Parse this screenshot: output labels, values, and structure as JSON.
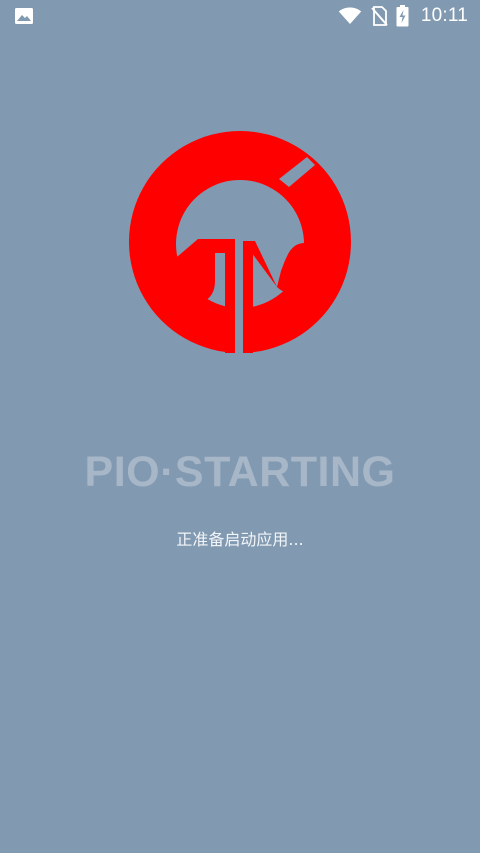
{
  "status_bar": {
    "time": "10:11",
    "icons": [
      "image-icon",
      "wifi-icon",
      "no-sim-icon",
      "battery-charging-icon"
    ]
  },
  "app": {
    "title": "PIO·STARTING",
    "message": "正准备启动应用..."
  },
  "colors": {
    "background": "#8199b1",
    "logo_red": "#ff0000",
    "title_text": "#a7b7c8",
    "message_text": "#f2f5f8"
  }
}
